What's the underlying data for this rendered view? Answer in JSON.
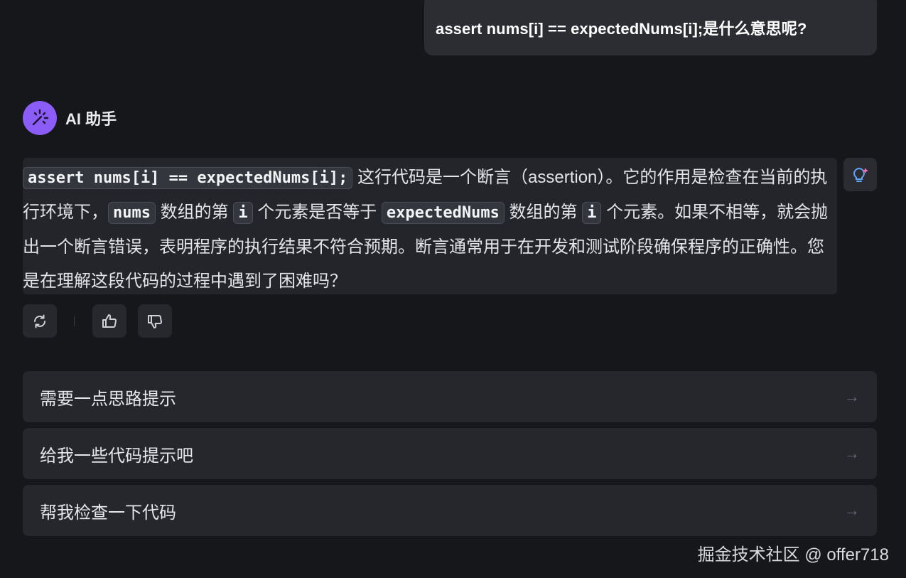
{
  "user_message": {
    "text": "assert nums[i] == expectedNums[i];是什么意思呢?"
  },
  "assistant": {
    "name": "AI 助手",
    "answer": {
      "code1": "assert nums[i] == expectedNums[i];",
      "t1": " 这行代码是一个断言（assertion）。它的作用是检查在当前的执行环境下，",
      "code2": "nums",
      "t2": " 数组的第 ",
      "code3": "i",
      "t3": " 个元素是否等于 ",
      "code4": "expectedNums",
      "t4": " 数组的第 ",
      "code5": "i",
      "t5": " 个元素。如果不相等，就会抛出一个断言错误，表明程序的执行结果不符合预期。断言通常用于在开发和测试阶段确保程序的正确性。您是在理解这段代码的过程中遇到了困难吗？"
    }
  },
  "actions": {
    "regenerate_icon": "refresh-icon",
    "like_icon": "thumbs-up-icon",
    "dislike_icon": "thumbs-down-icon"
  },
  "suggestions": [
    {
      "label": "需要一点思路提示",
      "arrow": "→"
    },
    {
      "label": "给我一些代码提示吧",
      "arrow": "→"
    },
    {
      "label": "帮我检查一下代码",
      "arrow": "→"
    }
  ],
  "watermark": "掘金技术社区 @ offer718",
  "colors": {
    "background": "#16171b",
    "bubble": "#2b2d33",
    "avatar": "#8b5cf6",
    "accent_pink": "#f472b6",
    "accent_blue": "#60a5fa"
  }
}
